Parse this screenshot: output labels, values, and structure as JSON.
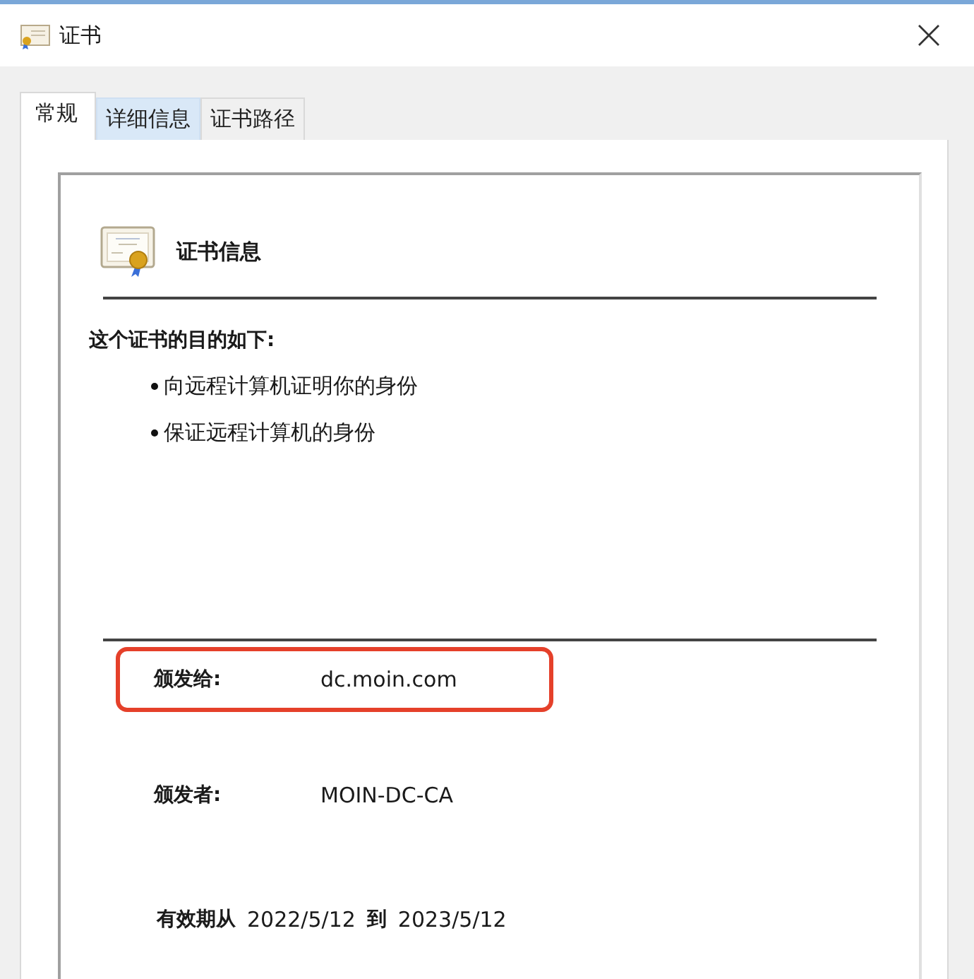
{
  "window": {
    "title": "证书"
  },
  "tabs": [
    {
      "label": "常规",
      "selected": true
    },
    {
      "label": "详细信息",
      "selected": false
    },
    {
      "label": "证书路径",
      "selected": false
    }
  ],
  "heading": "证书信息",
  "purpose_title": "这个证书的目的如下:",
  "purposes": [
    "向远程计算机证明你的身份",
    "保证远程计算机的身份"
  ],
  "fields": [
    {
      "label": "颁发给:",
      "value": "dc.moin.com",
      "highlighted": true
    },
    {
      "label": "颁发者:",
      "value": "MOIN-DC-CA",
      "highlighted": false
    }
  ],
  "validity": {
    "label": "有效期从",
    "from": "2022/5/12",
    "separator": "到",
    "to": "2023/5/12"
  }
}
